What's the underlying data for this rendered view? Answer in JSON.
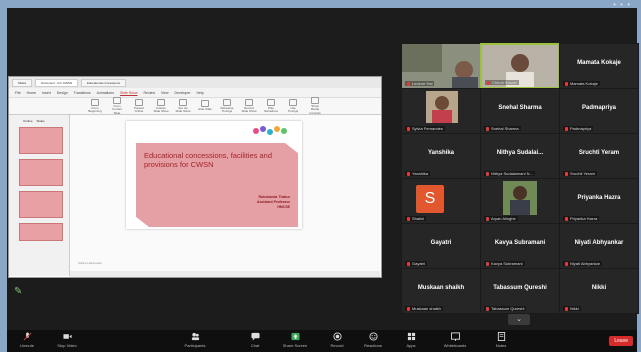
{
  "meeting": {
    "top_dots": "• • •"
  },
  "shared_window": {
    "tabs": [
      "Slides",
      "Document - For CWSN",
      "Educational concessions"
    ],
    "menus": [
      "File",
      "Home",
      "Insert",
      "Design",
      "Transitions",
      "Animations",
      "Slide Show",
      "Review",
      "View",
      "Developer",
      "Help"
    ],
    "active_menu": "Slide Show",
    "ribbon_buttons": [
      "From Beginning",
      "From Current Slide",
      "Present Online",
      "Custom Slide Show",
      "Set Up Slide Show",
      "Hide Slide",
      "Rehearse Timings",
      "Record Slide Show",
      "Play Narrations",
      "Use Timings",
      "Show Media Controls"
    ],
    "thumb_tabs": [
      "Outline",
      "Slides"
    ],
    "notes_hint": "Click to add notes",
    "slide": {
      "title": "Educational concessions, facilities and provisions for CWSN",
      "author_lines": [
        "Rukshanda Thakur",
        "Assistant Professor",
        "HMCSE"
      ]
    }
  },
  "participants": [
    {
      "name": "",
      "label": "Lecture Hal"
    },
    {
      "name": "",
      "label": "Chhoti Sawan"
    },
    {
      "name": "Mamata Kokaje",
      "label": "Mamata Kokaje"
    },
    {
      "name": "",
      "label": "Sylvia Fernandes"
    },
    {
      "name": "Snehal Sharma",
      "label": "Snehal Sharma"
    },
    {
      "name": "Padmapriya",
      "label": "Padmapriya"
    },
    {
      "name": "Yanshika",
      "label": "Yanshika"
    },
    {
      "name": "Nithya Sudalai...",
      "label": "Nithya Sudalaimani N..."
    },
    {
      "name": "Sruchti Yeram",
      "label": "Sruchti Yeram"
    },
    {
      "name": "",
      "label": "Shalini",
      "initial": "S"
    },
    {
      "name": "",
      "label": "Aryan Alinghe"
    },
    {
      "name": "Priyanka Hazra",
      "label": "Priyanka Hazra"
    },
    {
      "name": "Gayatri",
      "label": "Gayatri"
    },
    {
      "name": "Kavya Subramani",
      "label": "Kavya Subramani"
    },
    {
      "name": "Niyati Abhyankar",
      "label": "Niyati Abhyankar"
    },
    {
      "name": "Muskaan shaikh",
      "label": "Muskaan shaikh"
    },
    {
      "name": "Tabassum Qureshi",
      "label": "Tabassum Qureshi"
    },
    {
      "name": "Nikki",
      "label": "Nikki"
    }
  ],
  "pager_icon": "chevron-down",
  "toolbar": {
    "unmute": "Unmute",
    "stop_video": "Stop Video",
    "participants": "Participants",
    "participants_count": "22",
    "chat": "Chat",
    "share_screen": "Share Screen",
    "record": "Record",
    "reactions": "Reactions",
    "apps": "Apps",
    "whiteboards": "Whiteboards",
    "notes": "Notes",
    "leave": "Leave"
  }
}
